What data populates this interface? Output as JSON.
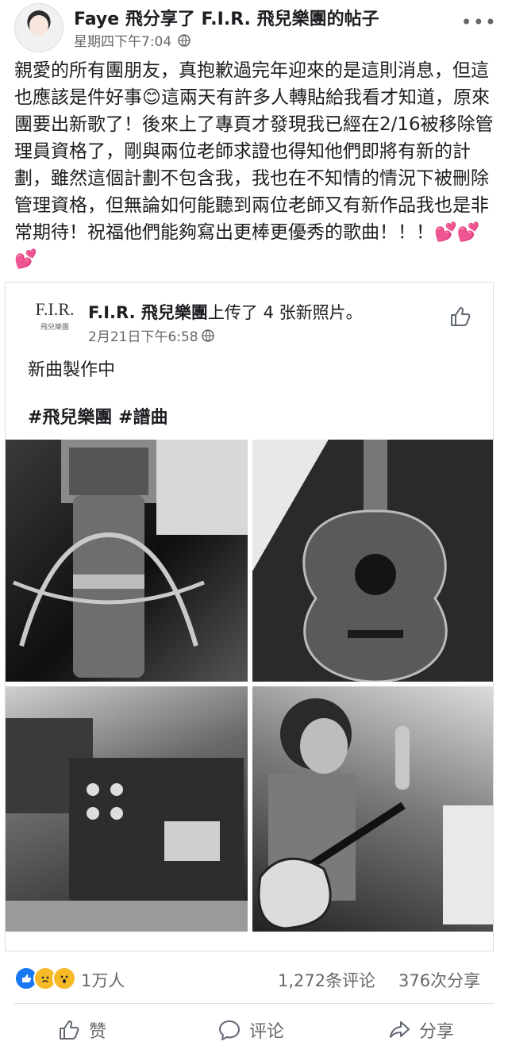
{
  "post": {
    "author": "Faye 飛",
    "shared_text": "分享了 F.I.R. 飛兒樂團的帖子",
    "timestamp": "星期四下午7:04",
    "privacy_icon": "globe-icon",
    "more_icon": "more-dots-icon",
    "body": "親愛的所有團朋友，真抱歉過完年迎來的是這則消息，但這也應該是件好事😊這兩天有許多人轉貼給我看才知道，原來團要出新歌了！後來上了專頁才發現我已經在2/16被移除管理員資格了，剛與兩位老師求證也得知他們即將有新的計劃，雖然這個計劃不包含我，我也在不知情的情況下被刪除管理資格，但無論如何能聽到兩位老師又有新作品我也是非常期待！祝福他們能夠寫出更棒更優秀的歌曲！！！💕💕💕"
  },
  "shared_card": {
    "logo_text": "F.I.R.",
    "logo_sub": "飛兒樂團",
    "page_name": "F.I.R. 飛兒樂團",
    "action_text": "上传了 4 张新照片。",
    "timestamp": "2月21日下午6:58",
    "line1": "新曲製作中",
    "hashtags": "#飛兒樂團 #譜曲",
    "photo_icons": [
      "microphone-photo",
      "acoustic-guitar-photo",
      "audio-equipment-photo",
      "musician-guitar-photo"
    ]
  },
  "stats": {
    "reactions": "1万人",
    "comments": "1,272条评论",
    "shares": "376次分享"
  },
  "actions": {
    "like": "赞",
    "comment": "评论",
    "share": "分享"
  },
  "colors": {
    "facebook_blue": "#1877f2",
    "reaction_yellow": "#f7b928",
    "secondary_text": "#65676b"
  }
}
